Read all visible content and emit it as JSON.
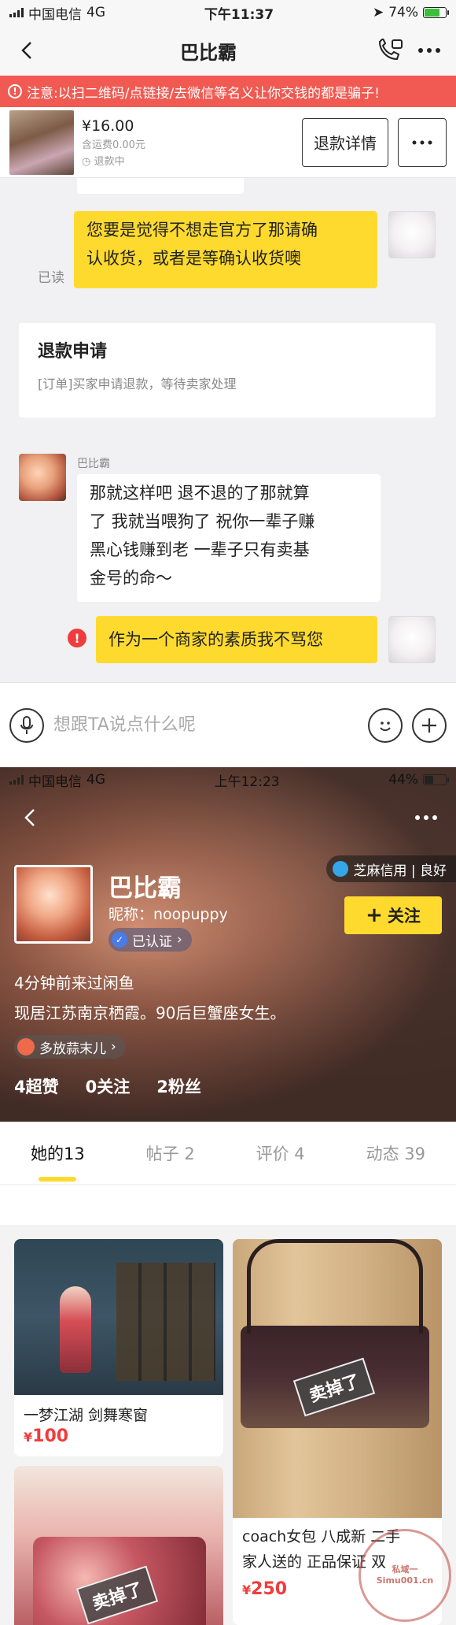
{
  "chat_status": {
    "carrier": "中国电信",
    "network": "4G",
    "time": "下午11:37",
    "battery": "74%"
  },
  "chat_nav": {
    "title": "巴比霸"
  },
  "warning": {
    "text": "注意:以扫二维码/点链接/去微信等名义让你交钱的都是骗子!"
  },
  "order": {
    "price": "¥16.00",
    "shipping": "含运费0.00元",
    "status": "退款中",
    "refund_detail_label": "退款详情"
  },
  "chat": {
    "msg1_lines": [
      "您要是觉得不想走官方了那请确",
      "认收货，或者是等确认收货噢"
    ],
    "read_label": "已读",
    "system_title": "退款申请",
    "system_desc": "[订单]买家申请退款，等待卖家处理",
    "sender_name": "巴比霸",
    "msg2_lines": [
      "那就这样吧 退不退的了那就算",
      "了 我就当喂狗了 祝你一辈子赚",
      "黑心钱赚到老  一辈子只有卖基",
      "金号的命～"
    ],
    "msg3": "作为一个商家的素质我不骂您",
    "error_mark": "!"
  },
  "input": {
    "placeholder": "想跟TA说点什么呢"
  },
  "profile_status": {
    "carrier": "中国电信",
    "network": "4G",
    "time": "上午12:23",
    "battery": "44%"
  },
  "profile": {
    "name": "巴比霸",
    "nickname": "昵称：noopuppy",
    "verified": "已认证",
    "credit": "芝麻信用 | 良好",
    "follow_label": "关注",
    "last_seen": "4分钟前来过闲鱼",
    "bio": "现居江苏南京栖霞。90后巨蟹座女生。",
    "tag": "多放蒜末儿",
    "stats": [
      "4超赞",
      "0关注",
      "2粉丝"
    ]
  },
  "tabs": [
    "她的13",
    "帖子 2",
    "评价 4",
    "动态 39"
  ],
  "items": [
    {
      "title": "一梦江湖 剑舞寒窗",
      "price": "100",
      "sold": ""
    },
    {
      "title_lines": [
        "coach女包 八成新 二手",
        "家人送的 正品保证 双"
      ],
      "price": "250",
      "sold": "卖掉了"
    },
    {
      "sold": "卖掉了"
    }
  ],
  "watermark": "私域一Simu001.cn",
  "colors": {
    "accent": "#ffda2e",
    "warning": "#f05a52",
    "price": "#f03c3c"
  }
}
